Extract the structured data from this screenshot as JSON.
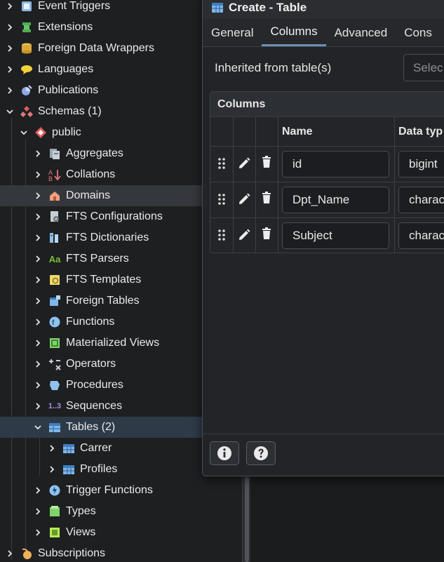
{
  "tree": {
    "items": [
      {
        "label": "Event Triggers",
        "icon": "event-trigger-icon"
      },
      {
        "label": "Extensions",
        "icon": "extension-icon"
      },
      {
        "label": "Foreign Data Wrappers",
        "icon": "foreign-data-wrapper-icon"
      },
      {
        "label": "Languages",
        "icon": "language-icon"
      },
      {
        "label": "Publications",
        "icon": "publication-icon"
      },
      {
        "label": "Schemas (1)",
        "icon": "schema-icon"
      },
      {
        "label": "public",
        "icon": "public-schema-icon"
      },
      {
        "label": "Aggregates",
        "icon": "aggregate-icon"
      },
      {
        "label": "Collations",
        "icon": "collation-icon"
      },
      {
        "label": "Domains",
        "icon": "domain-icon"
      },
      {
        "label": "FTS Configurations",
        "icon": "fts-configuration-icon"
      },
      {
        "label": "FTS Dictionaries",
        "icon": "fts-dictionary-icon"
      },
      {
        "label": "FTS Parsers",
        "icon": "fts-parser-icon",
        "icon_text": "Aa"
      },
      {
        "label": "FTS Templates",
        "icon": "fts-template-icon"
      },
      {
        "label": "Foreign Tables",
        "icon": "foreign-table-icon"
      },
      {
        "label": "Functions",
        "icon": "function-icon"
      },
      {
        "label": "Materialized Views",
        "icon": "materialized-view-icon"
      },
      {
        "label": "Operators",
        "icon": "operator-icon"
      },
      {
        "label": "Procedures",
        "icon": "procedure-icon"
      },
      {
        "label": "Sequences",
        "icon": "sequence-icon",
        "icon_text": "1..3"
      },
      {
        "label": "Tables (2)",
        "icon": "tables-icon"
      },
      {
        "label": "Carrer",
        "icon": "table-icon"
      },
      {
        "label": "Profiles",
        "icon": "table-icon"
      },
      {
        "label": "Trigger Functions",
        "icon": "trigger-function-icon"
      },
      {
        "label": "Types",
        "icon": "type-icon"
      },
      {
        "label": "Views",
        "icon": "view-icon"
      },
      {
        "label": "Subscriptions",
        "icon": "subscription-icon"
      }
    ]
  },
  "dialog": {
    "title": "Create - Table",
    "tabs": [
      "General",
      "Columns",
      "Advanced",
      "Cons"
    ],
    "active_tab": "Columns",
    "inherited_label": "Inherited from table(s)",
    "inherited_placeholder": "Selec",
    "columns_section_title": "Columns",
    "grid_headers": {
      "name": "Name",
      "data_type": "Data typ"
    },
    "columns": [
      {
        "name": "id",
        "data_type": "bigint"
      },
      {
        "name": "Dpt_Name",
        "data_type": "charac"
      },
      {
        "name": "Subject",
        "data_type": "charac"
      }
    ]
  },
  "colors": {
    "background": "#1e1f21",
    "highlight_row": "#34373c",
    "selected_row": "#2e3a48",
    "tab_accent": "#6c8fb8"
  }
}
